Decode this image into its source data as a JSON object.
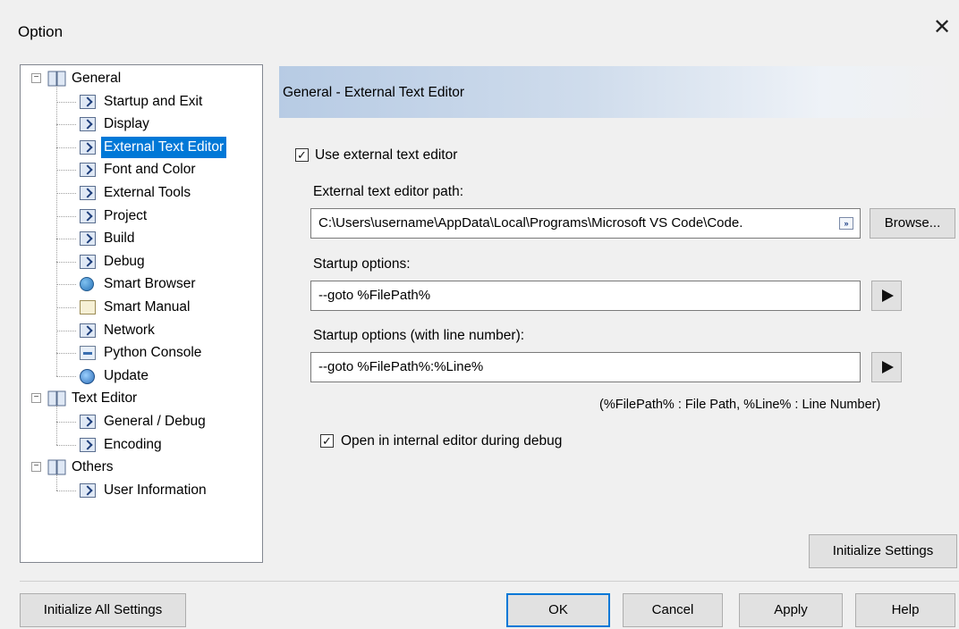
{
  "window": {
    "title": "Option",
    "close_glyph": "✕"
  },
  "tree": {
    "nodes": [
      {
        "label": "General",
        "level": 0,
        "icon": "book-icon",
        "expander": "−"
      },
      {
        "label": "Startup and Exit",
        "level": 1,
        "icon": "page-icon"
      },
      {
        "label": "Display",
        "level": 1,
        "icon": "page-icon"
      },
      {
        "label": "External Text Editor",
        "level": 1,
        "icon": "page-icon",
        "selected": true
      },
      {
        "label": "Font and Color",
        "level": 1,
        "icon": "page-icon"
      },
      {
        "label": "External Tools",
        "level": 1,
        "icon": "page-icon"
      },
      {
        "label": "Project",
        "level": 1,
        "icon": "page-icon"
      },
      {
        "label": "Build",
        "level": 1,
        "icon": "page-icon"
      },
      {
        "label": "Debug",
        "level": 1,
        "icon": "page-icon"
      },
      {
        "label": "Smart Browser",
        "level": 1,
        "icon": "globe-icon"
      },
      {
        "label": "Smart Manual",
        "level": 1,
        "icon": "manual-icon"
      },
      {
        "label": "Network",
        "level": 1,
        "icon": "page-icon"
      },
      {
        "label": "Python Console",
        "level": 1,
        "icon": "console-icon"
      },
      {
        "label": "Update",
        "level": 1,
        "icon": "update-icon"
      },
      {
        "label": "Text Editor",
        "level": 0,
        "icon": "book-icon",
        "expander": "−"
      },
      {
        "label": "General / Debug",
        "level": 1,
        "icon": "page-icon"
      },
      {
        "label": "Encoding",
        "level": 1,
        "icon": "page-icon"
      },
      {
        "label": "Others",
        "level": 0,
        "icon": "book-icon",
        "expander": "−"
      },
      {
        "label": "User Information",
        "level": 1,
        "icon": "page-icon"
      }
    ]
  },
  "panel": {
    "header": "General - External Text Editor",
    "use_external": {
      "label": "Use external text editor",
      "checked": true
    },
    "path_label": "External text editor path:",
    "path_value": "C:\\Users\\username\\AppData\\Local\\Programs\\Microsoft VS Code\\Code.",
    "path_more_glyph": "»",
    "browse_label": "Browse...",
    "startup_label": "Startup options:",
    "startup_value": "--goto %FilePath%",
    "startup_line_label": "Startup options (with line number):",
    "startup_line_value": "--goto %FilePath%:%Line%",
    "hint": "(%FilePath% : File Path, %Line% : Line Number)",
    "open_internal": {
      "label": "Open in internal editor during debug",
      "checked": true
    },
    "initialize_settings_label": "Initialize Settings"
  },
  "footer": {
    "initialize_all_label": "Initialize All Settings",
    "ok_label": "OK",
    "cancel_label": "Cancel",
    "apply_label": "Apply",
    "help_label": "Help"
  },
  "colors": {
    "selection": "#0078d7",
    "header_gradient_start": "#b7cbe4"
  }
}
